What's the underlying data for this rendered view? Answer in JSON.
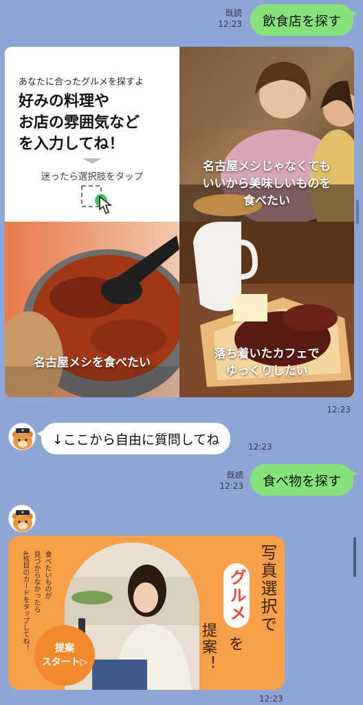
{
  "messages": {
    "m1": {
      "text": "飲食店を探す",
      "read": "既読",
      "time": "12:23"
    },
    "card": {
      "intro": {
        "small": "あなたに合ったグルメを探すよ",
        "heading_lines": [
          "好みの料理や",
          "お店の雰囲気など",
          "を入力してね！"
        ],
        "hint": "迷ったら選択肢をタップ"
      },
      "options": [
        {
          "lines": [
            "名古屋メシじゃなくても",
            "いいから美味しいものを",
            "食べたい"
          ]
        },
        {
          "lines": [
            "名古屋メシを食べたい"
          ]
        },
        {
          "lines": [
            "落ち着いたカフェで",
            "ゆっくりしたい"
          ]
        }
      ],
      "time": "12:23"
    },
    "m2": {
      "text": "↓ここから自由に質問してね",
      "time": "12:23"
    },
    "m3": {
      "text": "食べ物を探す",
      "read": "既読",
      "time": "12:23"
    },
    "photo_card": {
      "side_text": [
        "食べたいものが",
        "見つからなかったら",
        "4枚目のカードをタップしてね！"
      ],
      "button": [
        "提案",
        "スタート▷"
      ],
      "vertical_words": [
        "写真選択で",
        "グルメ",
        "を",
        "提案！"
      ],
      "time": "12:23"
    }
  },
  "colors": {
    "background": "#8fa6d4",
    "sent_bubble": "#86e27a",
    "orange": "#f6a04a"
  }
}
